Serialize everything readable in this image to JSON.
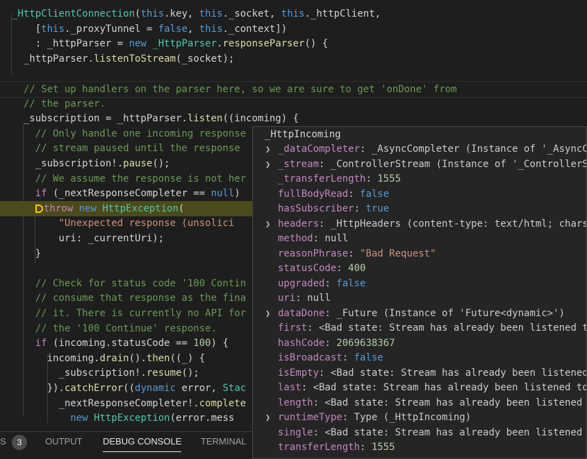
{
  "editor": {
    "lines": [
      [
        [
          "t-type",
          "_HttpClientConnection"
        ],
        [
          "t-def",
          "("
        ],
        [
          "t-kw",
          "this"
        ],
        [
          "t-def",
          ".key, "
        ],
        [
          "t-kw",
          "this"
        ],
        [
          "t-def",
          "._socket, "
        ],
        [
          "t-kw",
          "this"
        ],
        [
          "t-def",
          "._httpClient,"
        ]
      ],
      [
        [
          "t-def",
          "    ["
        ],
        [
          "t-kw",
          "this"
        ],
        [
          "t-def",
          "._proxyTunnel = "
        ],
        [
          "t-kw",
          "false"
        ],
        [
          "t-def",
          ", "
        ],
        [
          "t-kw",
          "this"
        ],
        [
          "t-def",
          "._context])"
        ]
      ],
      [
        [
          "t-def",
          "    : _httpParser = "
        ],
        [
          "t-kw",
          "new"
        ],
        [
          "t-def",
          " "
        ],
        [
          "t-type",
          "_HttpParser"
        ],
        [
          "t-def",
          "."
        ],
        [
          "t-fn",
          "responseParser"
        ],
        [
          "t-def",
          "() {"
        ]
      ],
      [
        [
          "t-def",
          "  _httpParser."
        ],
        [
          "t-fn",
          "listenToStream"
        ],
        [
          "t-def",
          "(_socket);"
        ]
      ],
      [
        [
          "t-def",
          ""
        ]
      ],
      [
        [
          "t-cmt",
          "  // Set up handlers on the parser here, so we are sure to get 'onDone' from"
        ]
      ],
      [
        [
          "t-cmt",
          "  // the parser."
        ]
      ],
      [
        [
          "t-def",
          "  _subscription = _httpParser."
        ],
        [
          "t-fn",
          "listen"
        ],
        [
          "t-def",
          "((incoming) {"
        ]
      ],
      [
        [
          "t-cmt",
          "    // Only handle one incoming response"
        ]
      ],
      [
        [
          "t-cmt",
          "    // stream paused until the response"
        ]
      ],
      [
        [
          "t-def",
          "    _subscription!."
        ],
        [
          "t-fn",
          "pause"
        ],
        [
          "t-def",
          "();"
        ]
      ],
      [
        [
          "t-cmt",
          "    // We assume the response is not her"
        ]
      ],
      [
        [
          "t-def",
          "    "
        ],
        [
          "t-ctrl",
          "if"
        ],
        [
          "t-def",
          " (_nextResponseCompleter == "
        ],
        [
          "t-kw",
          "null"
        ],
        [
          "t-def",
          ")"
        ]
      ],
      [
        [
          "t-ctrl",
          "throw"
        ],
        [
          "t-def",
          " "
        ],
        [
          "t-kw",
          "new"
        ],
        [
          "t-def",
          " "
        ],
        [
          "t-type",
          "HttpException"
        ],
        [
          "t-def",
          "("
        ]
      ],
      [
        [
          "t-str",
          "        \"Unexpected response (unsolici"
        ]
      ],
      [
        [
          "t-def",
          "        uri: _currentUri);"
        ]
      ],
      [
        [
          "t-def",
          "    }"
        ]
      ],
      [
        [
          "t-def",
          ""
        ]
      ],
      [
        [
          "t-cmt",
          "    // Check for status code '100 Contin"
        ]
      ],
      [
        [
          "t-cmt",
          "    // consume that response as the fina"
        ]
      ],
      [
        [
          "t-cmt",
          "    // it. There is currently no API for"
        ]
      ],
      [
        [
          "t-cmt",
          "    // the '100 Continue' response."
        ]
      ],
      [
        [
          "t-def",
          "    "
        ],
        [
          "t-ctrl",
          "if"
        ],
        [
          "t-def",
          " (incoming.statusCode == "
        ],
        [
          "t-num",
          "100"
        ],
        [
          "t-def",
          ") {"
        ]
      ],
      [
        [
          "t-def",
          "      incoming."
        ],
        [
          "t-fn",
          "drain"
        ],
        [
          "t-def",
          "()."
        ],
        [
          "t-fn",
          "then"
        ],
        [
          "t-def",
          "((_) {"
        ]
      ],
      [
        [
          "t-def",
          "        _subscription!."
        ],
        [
          "t-fn",
          "resume"
        ],
        [
          "t-def",
          "();"
        ]
      ],
      [
        [
          "t-def",
          "      })."
        ],
        [
          "t-fn",
          "catchError"
        ],
        [
          "t-def",
          "(("
        ],
        [
          "t-kw",
          "dynamic"
        ],
        [
          "t-def",
          " error, "
        ],
        [
          "t-type",
          "Stac"
        ]
      ],
      [
        [
          "t-def",
          "        _nextResponseCompleter!."
        ],
        [
          "t-fn",
          "complete"
        ]
      ],
      [
        [
          "t-def",
          "          "
        ],
        [
          "t-kw",
          "new"
        ],
        [
          "t-def",
          " "
        ],
        [
          "t-type",
          "HttpException"
        ],
        [
          "t-def",
          "(error.mess"
        ]
      ]
    ]
  },
  "hover": {
    "title": "_HttpIncoming",
    "rows": [
      {
        "expand": true,
        "key": "_dataCompleter",
        "value": "_AsyncCompleter (Instance of '_AsyncCom",
        "kind": "vo"
      },
      {
        "expand": true,
        "key": "_stream",
        "value": "_ControllerStream (Instance of '_ControllerStr",
        "kind": "vo"
      },
      {
        "expand": false,
        "key": "_transferLength",
        "value": "1555",
        "kind": "vn"
      },
      {
        "expand": false,
        "key": "fullBodyRead",
        "value": "false",
        "kind": "vk"
      },
      {
        "expand": false,
        "key": "hasSubscriber",
        "value": "true",
        "kind": "vk"
      },
      {
        "expand": true,
        "key": "headers",
        "value": "_HttpHeaders (content-type: text/html; charset",
        "kind": "vo"
      },
      {
        "expand": false,
        "key": "method",
        "value": "null",
        "kind": "vnull"
      },
      {
        "expand": false,
        "key": "reasonPhrase",
        "value": "\"Bad Request\"",
        "kind": "vs"
      },
      {
        "expand": false,
        "key": "statusCode",
        "value": "400",
        "kind": "vn"
      },
      {
        "expand": false,
        "key": "upgraded",
        "value": "false",
        "kind": "vk"
      },
      {
        "expand": false,
        "key": "uri",
        "value": "null",
        "kind": "vnull"
      },
      {
        "expand": true,
        "key": "dataDone",
        "value": "_Future (Instance of 'Future<dynamic>')",
        "kind": "vo"
      },
      {
        "expand": false,
        "key": "first",
        "value": "<Bad state: Stream has already been listened to.",
        "kind": "ve"
      },
      {
        "expand": false,
        "key": "hashCode",
        "value": "2069638367",
        "kind": "vn"
      },
      {
        "expand": false,
        "key": "isBroadcast",
        "value": "false",
        "kind": "vk"
      },
      {
        "expand": false,
        "key": "isEmpty",
        "value": "<Bad state: Stream has already been listened t",
        "kind": "ve"
      },
      {
        "expand": false,
        "key": "last",
        "value": "<Bad state: Stream has already been listened to.",
        "kind": "ve"
      },
      {
        "expand": false,
        "key": "length",
        "value": "<Bad state: Stream has already been listened to.",
        "kind": "ve"
      },
      {
        "expand": true,
        "key": "runtimeType",
        "value": "Type (_HttpIncoming)",
        "kind": "vo"
      },
      {
        "expand": false,
        "key": "single",
        "value": "<Bad state: Stream has already been listened to.",
        "kind": "ve"
      },
      {
        "expand": false,
        "key": "transferLength",
        "value": "1555",
        "kind": "vn"
      }
    ]
  },
  "panel": {
    "problems_label": "S",
    "problems_count": "3",
    "tabs": [
      {
        "label": "OUTPUT",
        "active": false
      },
      {
        "label": "DEBUG CONSOLE",
        "active": true
      },
      {
        "label": "TERMINAL",
        "active": false
      }
    ]
  },
  "icons": {
    "chevron": "chevron-right-icon",
    "breakpoint": "breakpoint-arrow-icon"
  },
  "colors": {
    "highlight": "#4b4a1a",
    "breakpoint": "#ffcc00"
  }
}
